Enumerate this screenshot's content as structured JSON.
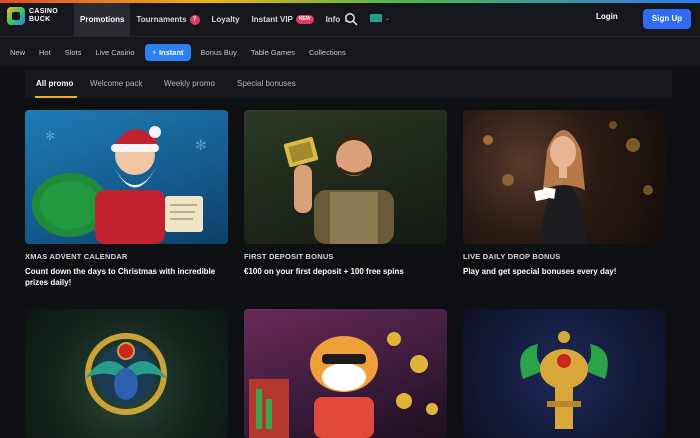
{
  "brand": {
    "logo_text_line1": "CASINO",
    "logo_text_line2": "BUCK"
  },
  "main_nav": {
    "promotions": "Promotions",
    "tournaments": "Tournaments",
    "tournaments_count": "7",
    "loyalty": "Loyalty",
    "instant_vip": "Instant VIP",
    "instant_vip_badge": "NEW",
    "info": "Info"
  },
  "auth": {
    "login": "Login",
    "signup": "Sign Up"
  },
  "sub_nav": {
    "items": [
      "New",
      "Hot",
      "Slots",
      "Live Casino",
      "Instant",
      "Bonus Buy",
      "Table Games",
      "Collections"
    ]
  },
  "promo_tabs": [
    "All promo",
    "Welcome pack",
    "Weekly promo",
    "Special bonuses"
  ],
  "cards": [
    {
      "tag": "XMAS ADVENT CALENDAR",
      "title": "Count down the days to Christmas with incredible prizes daily!"
    },
    {
      "tag": "FIRST DEPOSIT BONUS",
      "title": "€100 on your first deposit + 100 free spins"
    },
    {
      "tag": "LIVE DAILY DROP BONUS",
      "title": "Play and get special bonuses every day!"
    }
  ],
  "colors": {
    "accent": "#2f6cf2",
    "instant": "#2c80f0",
    "tab_underline": "#f0b21a",
    "badge": "#e23a5c"
  },
  "icons": [
    "search-icon",
    "chevron-down-icon",
    "lightning-icon"
  ]
}
